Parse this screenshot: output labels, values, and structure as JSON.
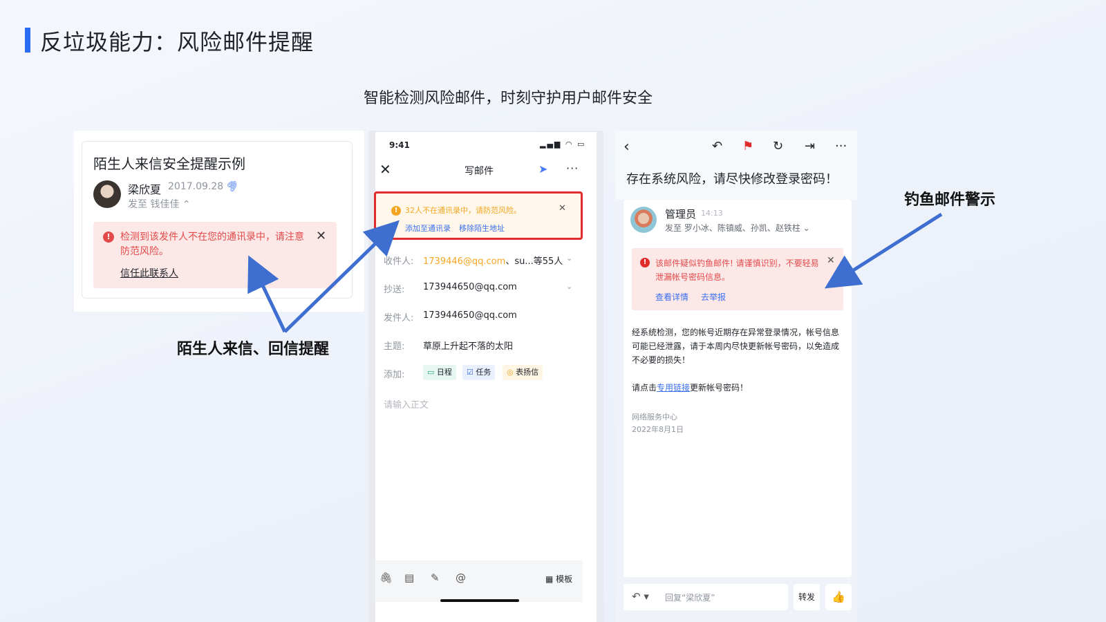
{
  "page": {
    "title": "反垃圾能力：风险邮件提醒",
    "subtitle": "智能检测风险邮件，时刻守护用户邮件安全"
  },
  "callouts": {
    "stranger": "陌生人来信、回信提醒",
    "phishing": "钓鱼邮件警示"
  },
  "panel1": {
    "title": "陌生人来信安全提醒示例",
    "sender": "梁欣夏",
    "date": "2017.09.28",
    "to": "发至  钱佳佳 ⌃",
    "warning": "检测到该发件人不在您的通讯录中，请注意防范风险。",
    "trust_link": "信任此联系人"
  },
  "panel2": {
    "status_time": "9:41",
    "header_title": "写邮件",
    "alert_text": "32人不在通讯录中，请防范风险。",
    "alert_add": "添加至通讯录",
    "alert_remove": "移除陌生地址",
    "to_label": "收件人:",
    "to_email": "1739446@qq.com",
    "to_rest": "、su...等55人",
    "cc_label": "抄送:",
    "cc_value": "173944650@qq.com",
    "from_label": "发件人:",
    "from_value": "173944650@qq.com",
    "subject_label": "主题:",
    "subject_value": "草原上升起不落的太阳",
    "add_label": "添加:",
    "tag_schedule": "日程",
    "tag_task": "任务",
    "tag_praise": "表扬信",
    "body_placeholder": "请输入正文",
    "template_label": "模板"
  },
  "panel3": {
    "subject": "存在系统风险，请尽快修改登录密码！",
    "sender": "管理员",
    "time": "14:13",
    "to": "发至  罗小冰、陈镇威、孙凯、赵铁柱  ⌄",
    "warning": "该邮件疑似钓鱼邮件! 请谨慎识别，不要轻易泄漏帐号密码信息。",
    "link_detail": "查看详情",
    "link_report": "去举报",
    "body": "经系统检测，您的帐号近期存在异常登录情况，帐号信息可能已经泄露，请于本周内尽快更新帐号密码，以免造成不必要的损失！",
    "body_prefix": "请点击",
    "body_link": "专用链接",
    "body_suffix": "更新帐号密码！",
    "sig_name": "网络服务中心",
    "sig_date": "2022年8月1日",
    "reply_placeholder": "回复“梁欣夏”",
    "forward": "转发"
  },
  "colors": {
    "accent": "#2b6cf6",
    "danger": "#e24a4a",
    "warning": "#f4a622",
    "link": "#3a6ff0",
    "arrow": "#3e6fd0"
  }
}
